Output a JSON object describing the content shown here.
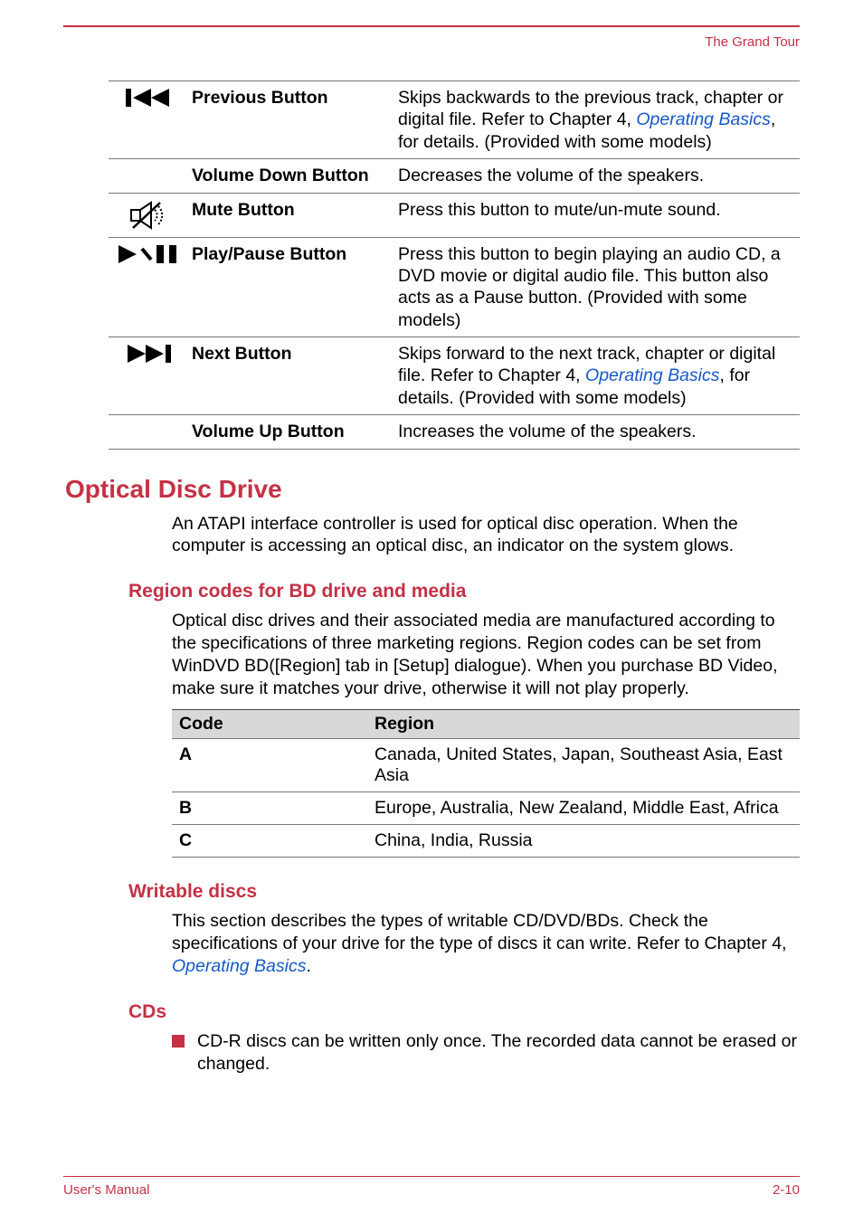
{
  "header": {
    "title": "The Grand Tour"
  },
  "buttons": [
    {
      "icon": "previous-icon",
      "label": "Previous Button",
      "desc_pre": "Skips backwards to the previous track, chapter or digital file. Refer to Chapter 4, ",
      "desc_link": "Operating Basics",
      "desc_post": ", for details. (Provided with some models)"
    },
    {
      "icon": "",
      "label": "Volume Down Button",
      "desc_pre": "Decreases the volume of the speakers.",
      "desc_link": "",
      "desc_post": ""
    },
    {
      "icon": "mute-icon",
      "label": "Mute Button",
      "desc_pre": "Press this button to mute/un-mute sound.",
      "desc_link": "",
      "desc_post": ""
    },
    {
      "icon": "play-pause-icon",
      "label": "Play/Pause Button",
      "desc_pre": "Press this button to begin playing an audio CD, a DVD movie or digital audio file. This button also acts as a Pause button. (Provided with some models)",
      "desc_link": "",
      "desc_post": ""
    },
    {
      "icon": "next-icon",
      "label": "Next Button",
      "desc_pre": "Skips forward to the next track, chapter or digital file. Refer to Chapter 4, ",
      "desc_link": "Operating Basics",
      "desc_post": ", for details. (Provided with some models)"
    },
    {
      "icon": "",
      "label": "Volume Up Button",
      "desc_pre": "Increases the volume of the speakers.",
      "desc_link": "",
      "desc_post": ""
    }
  ],
  "heading1": "Optical Disc Drive",
  "para1": "An ATAPI interface controller is used for optical disc operation. When the computer is accessing an optical disc, an indicator on the system glows.",
  "heading2": "Region codes for BD drive and media",
  "para2": "Optical disc drives and their associated media are manufactured according to the specifications of three marketing regions. Region codes can be set from WinDVD BD([Region] tab in [Setup] dialogue). When you purchase BD Video, make sure it matches your drive, otherwise it will not play properly.",
  "region_table": {
    "headers": [
      "Code",
      "Region"
    ],
    "rows": [
      [
        "A",
        "Canada, United States, Japan, Southeast Asia, East Asia"
      ],
      [
        "B",
        "Europe, Australia, New Zealand, Middle East, Africa"
      ],
      [
        "C",
        "China, India, Russia"
      ]
    ]
  },
  "heading3": "Writable discs",
  "para3_pre": "This section describes the types of writable CD/DVD/BDs. Check the specifications of your drive for the type of discs it can write. Refer to Chapter 4, ",
  "para3_link": "Operating Basics",
  "para3_post": ".",
  "heading4": "CDs",
  "bullet1": "CD-R discs can be written only once. The recorded data cannot be erased or changed.",
  "footer": {
    "left": "User's Manual",
    "right": "2-10"
  }
}
